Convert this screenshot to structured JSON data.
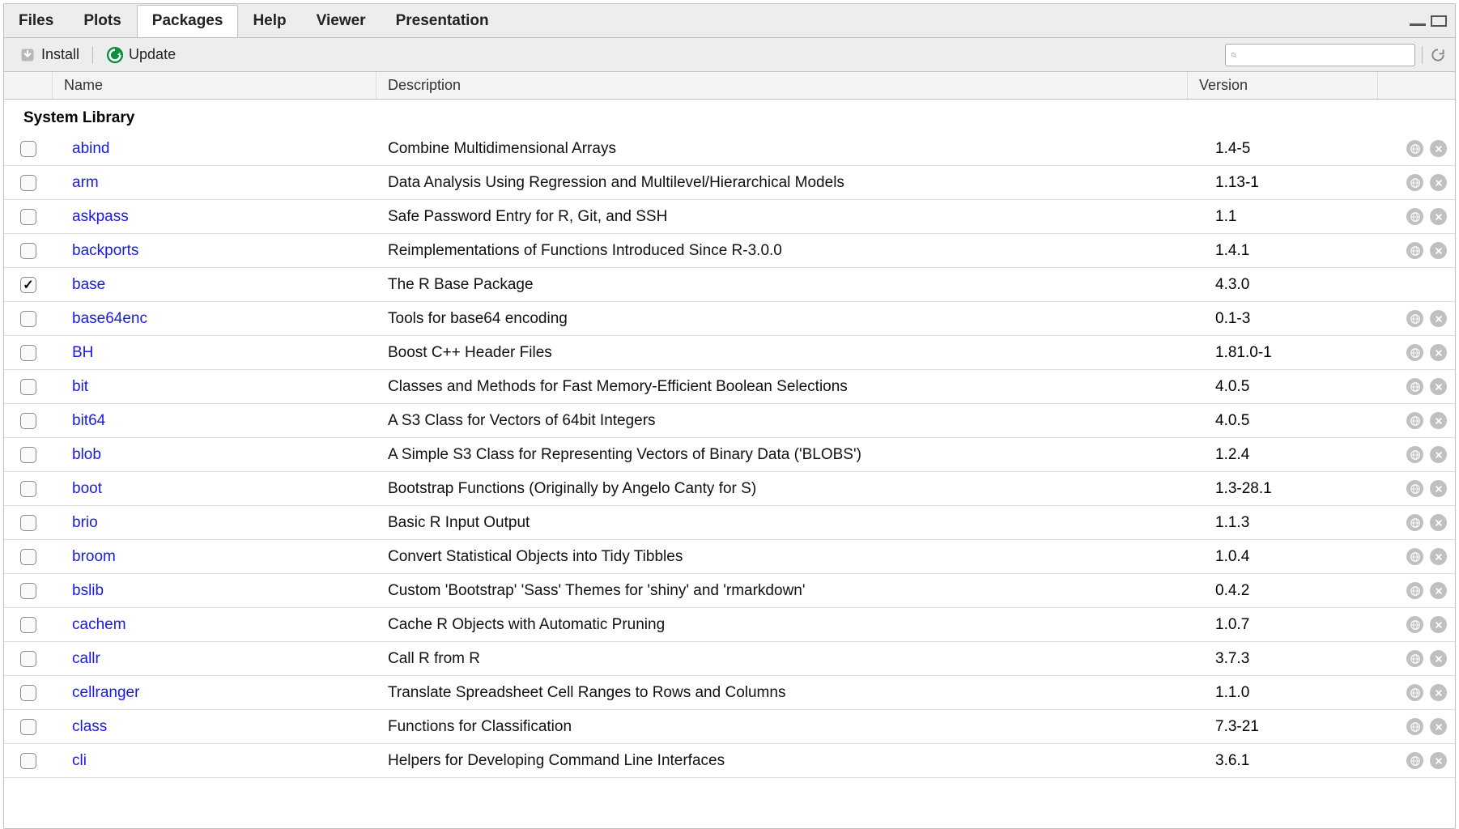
{
  "tabs": [
    "Files",
    "Plots",
    "Packages",
    "Help",
    "Viewer",
    "Presentation"
  ],
  "active_tab": "Packages",
  "toolbar": {
    "install_label": "Install",
    "update_label": "Update",
    "search_placeholder": ""
  },
  "headers": {
    "name": "Name",
    "description": "Description",
    "version": "Version"
  },
  "section_title": "System Library",
  "packages": [
    {
      "checked": false,
      "name": "abind",
      "desc": "Combine Multidimensional Arrays",
      "ver": "1.4-5",
      "actions": true
    },
    {
      "checked": false,
      "name": "arm",
      "desc": "Data Analysis Using Regression and Multilevel/Hierarchical Models",
      "ver": "1.13-1",
      "actions": true
    },
    {
      "checked": false,
      "name": "askpass",
      "desc": "Safe Password Entry for R, Git, and SSH",
      "ver": "1.1",
      "actions": true
    },
    {
      "checked": false,
      "name": "backports",
      "desc": "Reimplementations of Functions Introduced Since R-3.0.0",
      "ver": "1.4.1",
      "actions": true
    },
    {
      "checked": true,
      "name": "base",
      "desc": "The R Base Package",
      "ver": "4.3.0",
      "actions": false
    },
    {
      "checked": false,
      "name": "base64enc",
      "desc": "Tools for base64 encoding",
      "ver": "0.1-3",
      "actions": true
    },
    {
      "checked": false,
      "name": "BH",
      "desc": "Boost C++ Header Files",
      "ver": "1.81.0-1",
      "actions": true
    },
    {
      "checked": false,
      "name": "bit",
      "desc": "Classes and Methods for Fast Memory-Efficient Boolean Selections",
      "ver": "4.0.5",
      "actions": true
    },
    {
      "checked": false,
      "name": "bit64",
      "desc": "A S3 Class for Vectors of 64bit Integers",
      "ver": "4.0.5",
      "actions": true
    },
    {
      "checked": false,
      "name": "blob",
      "desc": "A Simple S3 Class for Representing Vectors of Binary Data ('BLOBS')",
      "ver": "1.2.4",
      "actions": true
    },
    {
      "checked": false,
      "name": "boot",
      "desc": "Bootstrap Functions (Originally by Angelo Canty for S)",
      "ver": "1.3-28.1",
      "actions": true
    },
    {
      "checked": false,
      "name": "brio",
      "desc": "Basic R Input Output",
      "ver": "1.1.3",
      "actions": true
    },
    {
      "checked": false,
      "name": "broom",
      "desc": "Convert Statistical Objects into Tidy Tibbles",
      "ver": "1.0.4",
      "actions": true
    },
    {
      "checked": false,
      "name": "bslib",
      "desc": "Custom 'Bootstrap' 'Sass' Themes for 'shiny' and 'rmarkdown'",
      "ver": "0.4.2",
      "actions": true
    },
    {
      "checked": false,
      "name": "cachem",
      "desc": "Cache R Objects with Automatic Pruning",
      "ver": "1.0.7",
      "actions": true
    },
    {
      "checked": false,
      "name": "callr",
      "desc": "Call R from R",
      "ver": "3.7.3",
      "actions": true
    },
    {
      "checked": false,
      "name": "cellranger",
      "desc": "Translate Spreadsheet Cell Ranges to Rows and Columns",
      "ver": "1.1.0",
      "actions": true
    },
    {
      "checked": false,
      "name": "class",
      "desc": "Functions for Classification",
      "ver": "7.3-21",
      "actions": true
    },
    {
      "checked": false,
      "name": "cli",
      "desc": "Helpers for Developing Command Line Interfaces",
      "ver": "3.6.1",
      "actions": true
    }
  ]
}
